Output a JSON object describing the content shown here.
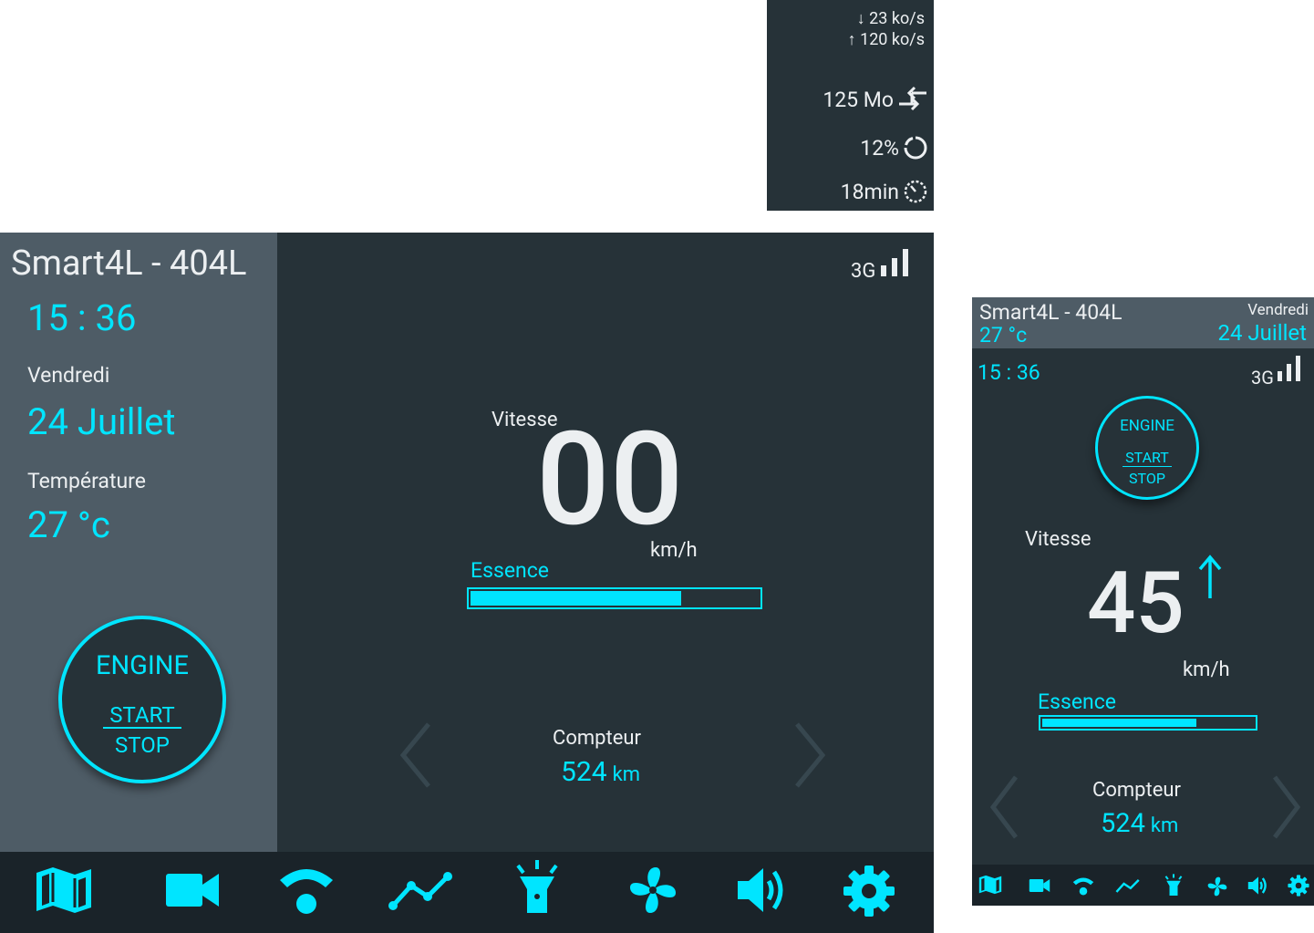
{
  "data_panel": {
    "download_rate": "↓ 23 ko/s",
    "upload_rate": "↑ 120 ko/s",
    "data_used": "125 Mo",
    "percent": "12%",
    "duration": "18min"
  },
  "landscape": {
    "title": "Smart4L - 404L",
    "time": "15 : 36",
    "day": "Vendredi",
    "date": "24 Juillet",
    "temp_label": "Température",
    "temp_value": "27 °c",
    "engine": {
      "label": "ENGINE",
      "start": "START",
      "stop": "STOP"
    },
    "network": "3G",
    "speed_label": "Vitesse",
    "speed_value": "00",
    "speed_unit": "km/h",
    "fuel_label": "Essence",
    "fuel_level": 0.73,
    "odometer_label": "Compteur",
    "odometer_value": "524",
    "odometer_unit": "km"
  },
  "portrait": {
    "title": "Smart4L - 404L",
    "temp_value": "27 °c",
    "day": "Vendredi",
    "date": "24 Juillet",
    "time": "15 : 36",
    "network": "3G",
    "engine": {
      "label": "ENGINE",
      "start": "START",
      "stop": "STOP"
    },
    "speed_label": "Vitesse",
    "speed_value": "45",
    "speed_unit": "km/h",
    "fuel_label": "Essence",
    "fuel_level": 0.73,
    "odometer_label": "Compteur",
    "odometer_value": "524",
    "odometer_unit": "km"
  },
  "nav_icons": [
    "map-icon",
    "camera-icon",
    "wifi-icon",
    "stats-icon",
    "flashlight-icon",
    "fan-icon",
    "volume-icon",
    "settings-icon"
  ],
  "colors": {
    "accent": "#00e5ff",
    "sidebar": "#4e5c66",
    "background": "#263238",
    "nav": "#1a2329",
    "text": "#eceff1"
  }
}
